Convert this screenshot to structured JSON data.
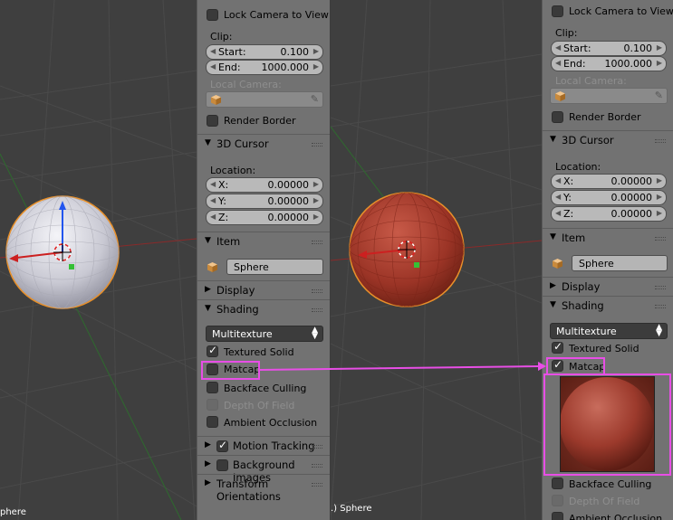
{
  "left_panel": {
    "lock_camera_label": "Lock Camera to View",
    "clip_label": "Clip:",
    "start_label": "Start:",
    "start_value": "0.100",
    "end_label": "End:",
    "end_value": "1000.000",
    "local_camera_label": "Local Camera:",
    "render_border_label": "Render Border",
    "cursor_header": "3D Cursor",
    "location_label": "Location:",
    "x_label": "X:",
    "x_value": "0.00000",
    "y_label": "Y:",
    "y_value": "0.00000",
    "z_label": "Z:",
    "z_value": "0.00000",
    "item_header": "Item",
    "object_name": "Sphere",
    "display_header": "Display",
    "shading_header": "Shading",
    "shading_mode": "Multitexture",
    "textured_solid_label": "Textured Solid",
    "textured_solid_checked": true,
    "matcap_label": "Matcap",
    "matcap_checked": false,
    "backface_label": "Backface Culling",
    "dof_label": "Depth Of Field",
    "ao_label": "Ambient Occlusion",
    "motion_tracking_header": "Motion Tracking",
    "motion_tracking_checked": true,
    "background_images_header": "Background Images",
    "transform_orientations_header": "Transform Orientations"
  },
  "right_panel": {
    "lock_camera_label": "Lock Camera to View",
    "clip_label": "Clip:",
    "start_label": "Start:",
    "start_value": "0.100",
    "end_label": "End:",
    "end_value": "1000.000",
    "local_camera_label": "Local Camera:",
    "render_border_label": "Render Border",
    "cursor_header": "3D Cursor",
    "location_label": "Location:",
    "x_label": "X:",
    "x_value": "0.00000",
    "y_label": "Y:",
    "y_value": "0.00000",
    "z_label": "Z:",
    "z_value": "0.00000",
    "item_header": "Item",
    "object_name": "Sphere",
    "display_header": "Display",
    "shading_header": "Shading",
    "shading_mode": "Multitexture",
    "textured_solid_label": "Textured Solid",
    "textured_solid_checked": true,
    "matcap_label": "Matcap",
    "matcap_checked": true,
    "backface_label": "Backface Culling",
    "dof_label": "Depth Of Field",
    "ao_label": "Ambient Occlusion"
  },
  "viewports": {
    "left_object_label": "phere",
    "right_object_label": ".) Sphere"
  },
  "colors": {
    "highlight": "#e84ee6",
    "panel_bg": "#727272",
    "viewport_bg": "#3f3f3f",
    "x_axis": "#cc2020",
    "y_axis": "#35a035",
    "z_axis": "#2255ee",
    "selection_outline": "#e8902a"
  },
  "icons": [
    "checkbox-icon",
    "cube-icon",
    "eyedropper-icon",
    "disclosure-triangle-icon",
    "grip-icon",
    "updown-arrow-icon",
    "cursor-icon",
    "arrow-icon"
  ]
}
